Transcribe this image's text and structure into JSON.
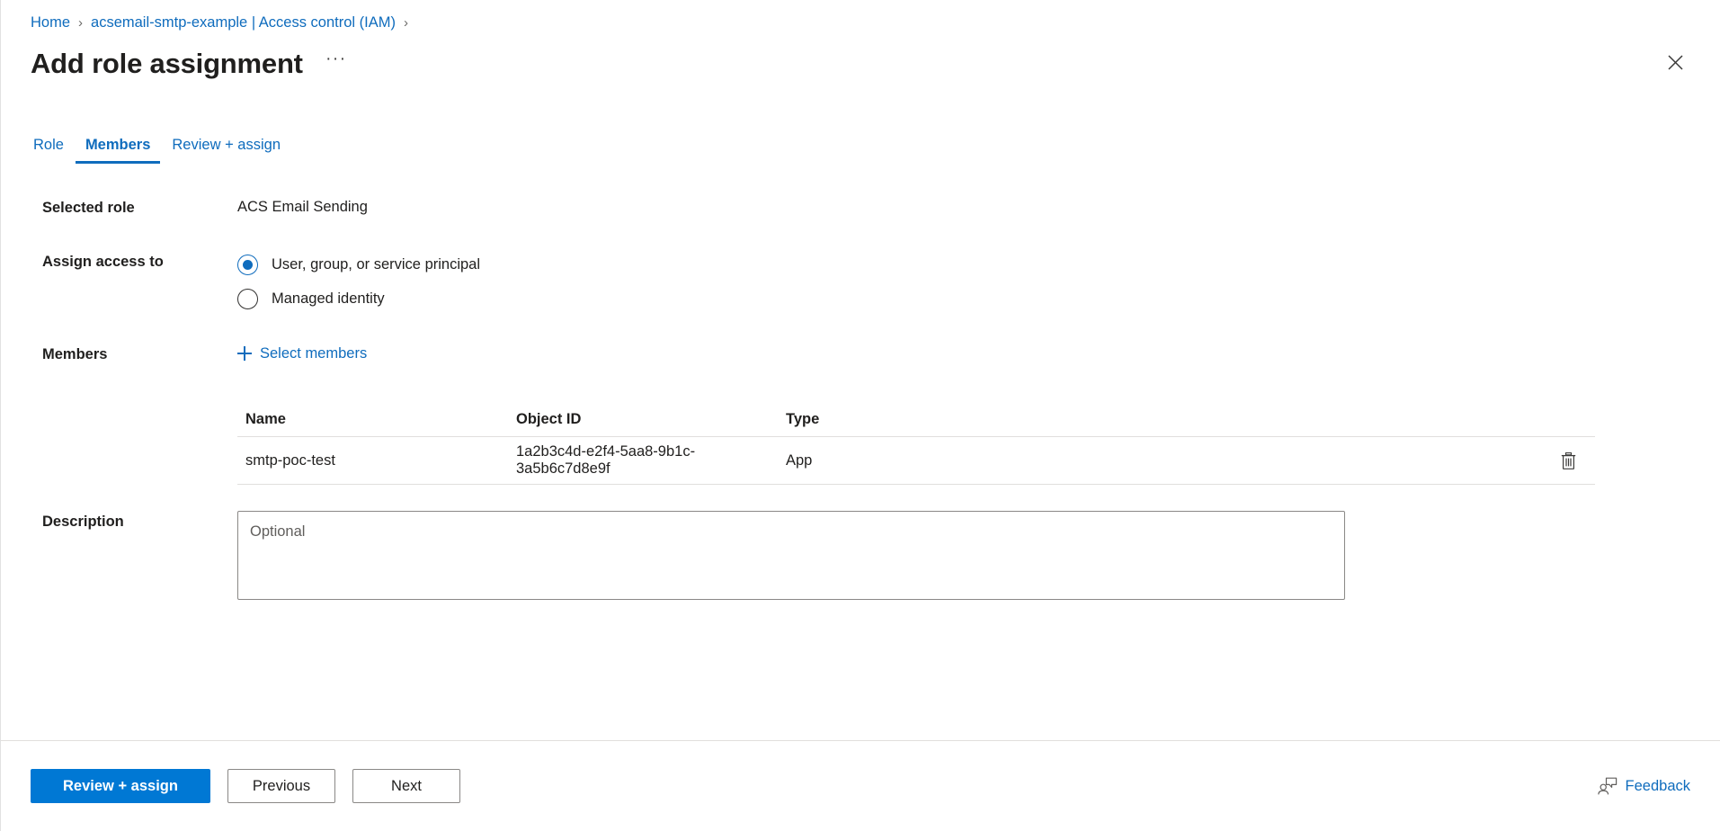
{
  "breadcrumb": {
    "items": [
      {
        "label": "Home"
      },
      {
        "label": "acsemail-smtp-example | Access control (IAM)"
      }
    ],
    "separator": "›"
  },
  "header": {
    "title": "Add role assignment",
    "overflow_label": "···",
    "close_icon": "close-icon"
  },
  "tabs": [
    {
      "label": "Role",
      "active": false
    },
    {
      "label": "Members",
      "active": true
    },
    {
      "label": "Review + assign",
      "active": false
    }
  ],
  "form": {
    "selected_role": {
      "label": "Selected role",
      "value": "ACS Email Sending"
    },
    "assign_access_to": {
      "label": "Assign access to",
      "options": [
        {
          "label": "User, group, or service principal",
          "checked": true
        },
        {
          "label": "Managed identity",
          "checked": false
        }
      ]
    },
    "members": {
      "label": "Members",
      "select_members_label": "Select members",
      "plus_icon": "plus-icon",
      "table": {
        "columns": [
          "Name",
          "Object ID",
          "Type"
        ],
        "rows": [
          {
            "name": "smtp-poc-test",
            "object_id": "1a2b3c4d-e2f4-5aa8-9b1c-3a5b6c7d8e9f",
            "type": "App",
            "delete_icon": "trash-icon"
          }
        ]
      }
    },
    "description": {
      "label": "Description",
      "placeholder": "Optional",
      "value": ""
    }
  },
  "footer": {
    "review_assign_label": "Review + assign",
    "previous_label": "Previous",
    "next_label": "Next",
    "feedback_label": "Feedback",
    "feedback_icon": "feedback-person-icon"
  },
  "colors": {
    "accent_blue": "#0f6cbd",
    "primary_button": "#0078d4",
    "text": "#201f1e",
    "border": "#e1dfdd"
  }
}
